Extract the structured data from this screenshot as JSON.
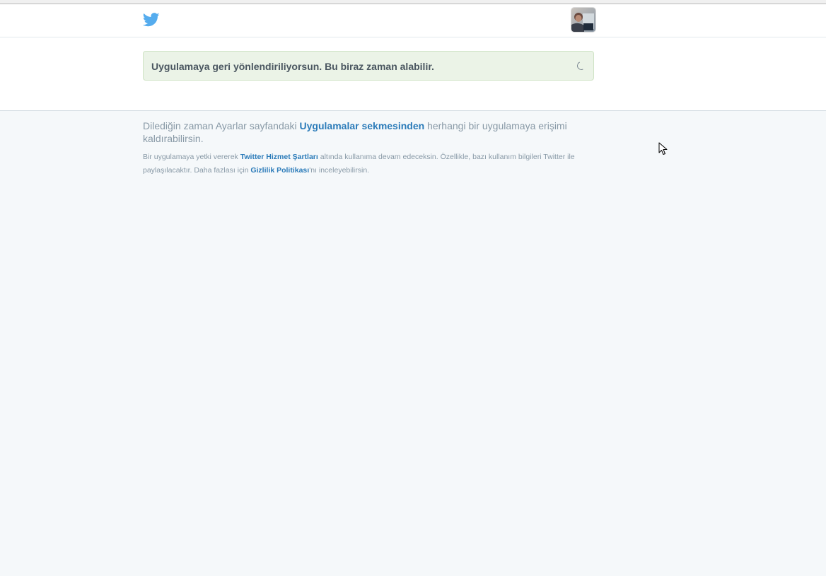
{
  "header": {
    "logo_icon": "twitter-bird-icon",
    "avatar_icon": "user-avatar",
    "brand_color": "#55acee"
  },
  "alert": {
    "message": "Uygulamaya geri yönlendiriliyorsun. Bu biraz zaman alabilir.",
    "spinner_icon": "loading-spinner-icon"
  },
  "info": {
    "prefix": "Dilediğin zaman Ayarlar sayfandaki ",
    "link": "Uygulamalar sekmesinden",
    "suffix": " herhangi bir uygulamaya erişimi kaldırabilirsin."
  },
  "legal": {
    "part1": "Bir uygulamaya yetki vererek ",
    "tos_link": "Twitter Hizmet Şartları",
    "part2": " altında kullanıma devam edeceksin. Özellikle, bazı kullanım bilgileri Twitter ile paylaşılacaktır. Daha fazlası için ",
    "privacy_link": "Gizlilik Politikası",
    "part3": "'nı inceleyebilirsin."
  }
}
